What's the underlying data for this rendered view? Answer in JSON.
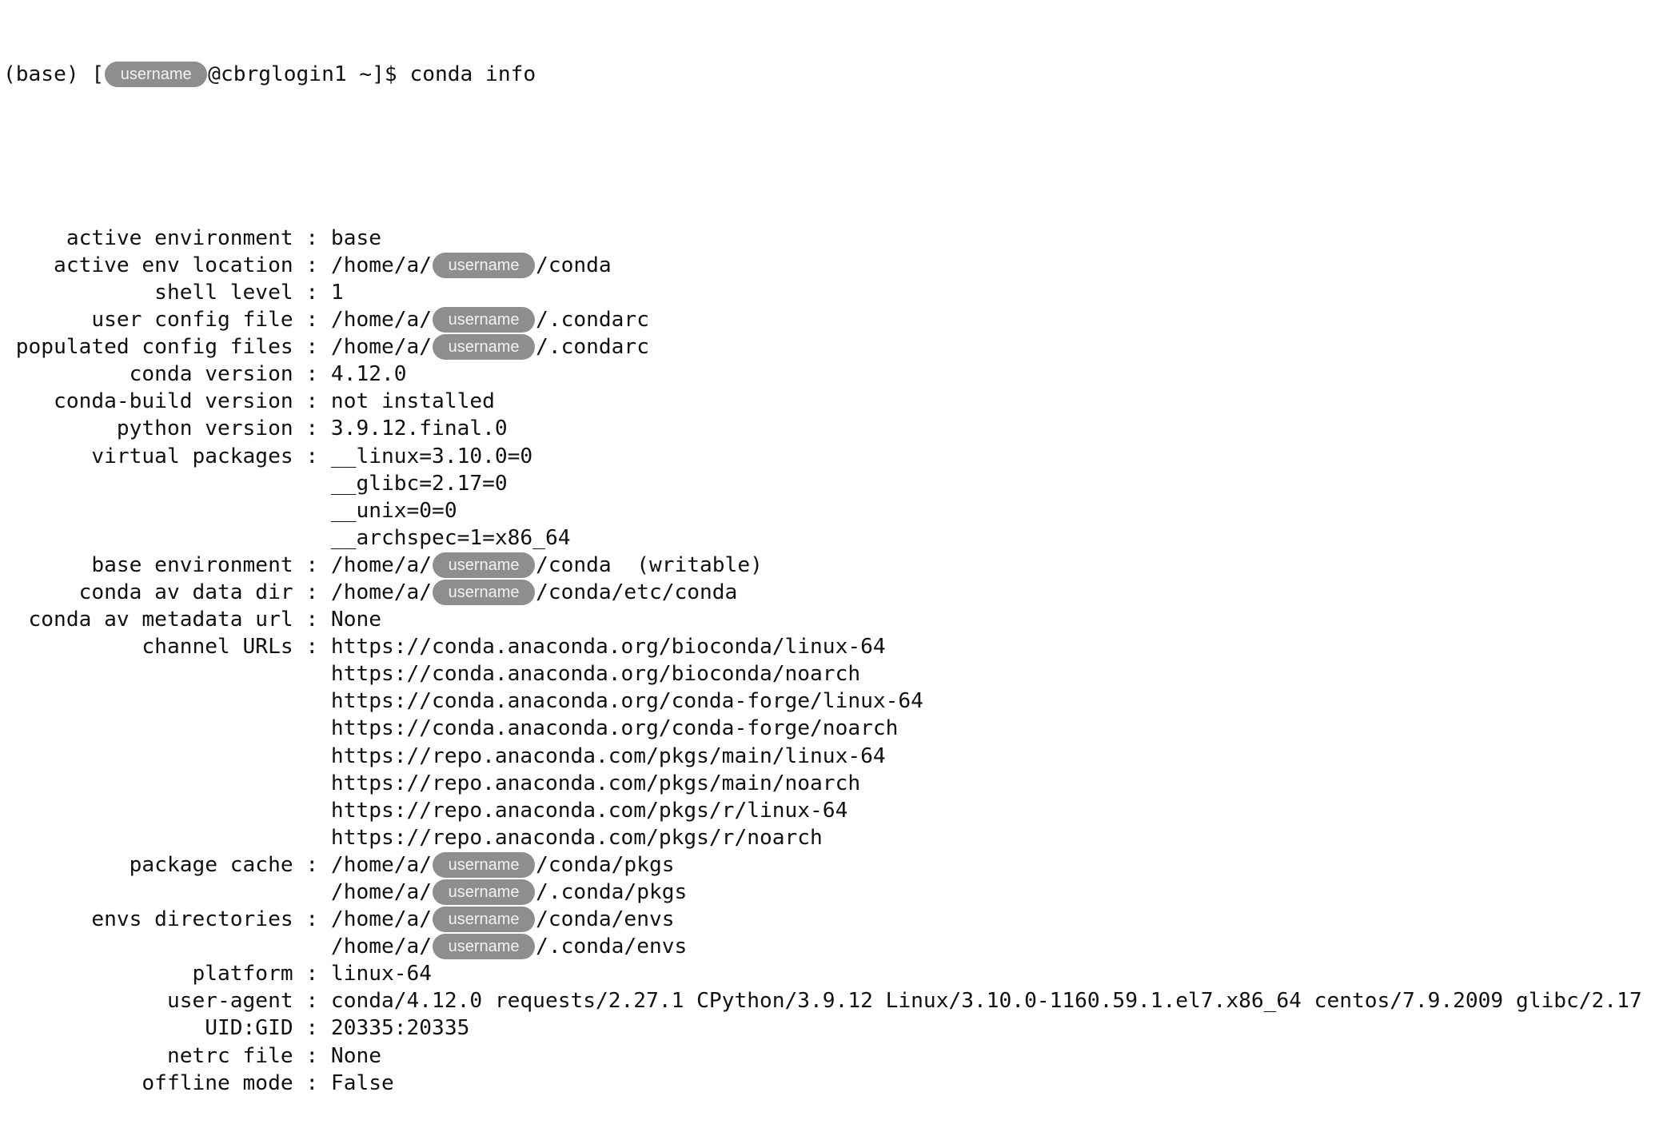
{
  "prompt": {
    "env": "(base)",
    "open_bracket": "[",
    "user_redacted": "username",
    "host_path": "@cbrglogin1 ~]$",
    "command": "conda info"
  },
  "redaction_label": "username",
  "info": [
    {
      "label": "active environment",
      "lines": [
        [
          "base"
        ]
      ]
    },
    {
      "label": "active env location",
      "lines": [
        [
          "/home/a/",
          "@user",
          "/conda"
        ]
      ]
    },
    {
      "label": "shell level",
      "lines": [
        [
          "1"
        ]
      ]
    },
    {
      "label": "user config file",
      "lines": [
        [
          "/home/a/",
          "@user",
          "/.condarc"
        ]
      ]
    },
    {
      "label": "populated config files",
      "lines": [
        [
          "/home/a/",
          "@user",
          "/.condarc"
        ]
      ]
    },
    {
      "label": "conda version",
      "lines": [
        [
          "4.12.0"
        ]
      ]
    },
    {
      "label": "conda-build version",
      "lines": [
        [
          "not installed"
        ]
      ]
    },
    {
      "label": "python version",
      "lines": [
        [
          "3.9.12.final.0"
        ]
      ]
    },
    {
      "label": "virtual packages",
      "lines": [
        [
          "__linux=3.10.0=0"
        ],
        [
          "__glibc=2.17=0"
        ],
        [
          "__unix=0=0"
        ],
        [
          "__archspec=1=x86_64"
        ]
      ]
    },
    {
      "label": "base environment",
      "lines": [
        [
          "/home/a/",
          "@user",
          "/conda  (writable)"
        ]
      ]
    },
    {
      "label": "conda av data dir",
      "lines": [
        [
          "/home/a/",
          "@user",
          "/conda/etc/conda"
        ]
      ]
    },
    {
      "label": "conda av metadata url",
      "lines": [
        [
          "None"
        ]
      ]
    },
    {
      "label": "channel URLs",
      "lines": [
        [
          "https://conda.anaconda.org/bioconda/linux-64"
        ],
        [
          "https://conda.anaconda.org/bioconda/noarch"
        ],
        [
          "https://conda.anaconda.org/conda-forge/linux-64"
        ],
        [
          "https://conda.anaconda.org/conda-forge/noarch"
        ],
        [
          "https://repo.anaconda.com/pkgs/main/linux-64"
        ],
        [
          "https://repo.anaconda.com/pkgs/main/noarch"
        ],
        [
          "https://repo.anaconda.com/pkgs/r/linux-64"
        ],
        [
          "https://repo.anaconda.com/pkgs/r/noarch"
        ]
      ]
    },
    {
      "label": "package cache",
      "lines": [
        [
          "/home/a/",
          "@user",
          "/conda/pkgs"
        ],
        [
          "/home/a/",
          "@user",
          "/.conda/pkgs"
        ]
      ]
    },
    {
      "label": "envs directories",
      "lines": [
        [
          "/home/a/",
          "@user",
          "/conda/envs"
        ],
        [
          "/home/a/",
          "@user",
          "/.conda/envs"
        ]
      ]
    },
    {
      "label": "platform",
      "lines": [
        [
          "linux-64"
        ]
      ]
    },
    {
      "label": "user-agent",
      "lines": [
        [
          "conda/4.12.0 requests/2.27.1 CPython/3.9.12 Linux/3.10.0-1160.59.1.el7.x86_64 centos/7.9.2009 glibc/2.17"
        ]
      ]
    },
    {
      "label": "UID:GID",
      "lines": [
        [
          "20335:20335"
        ]
      ]
    },
    {
      "label": "netrc file",
      "lines": [
        [
          "None"
        ]
      ]
    },
    {
      "label": "offline mode",
      "lines": [
        [
          "False"
        ]
      ]
    }
  ],
  "separator": " : "
}
